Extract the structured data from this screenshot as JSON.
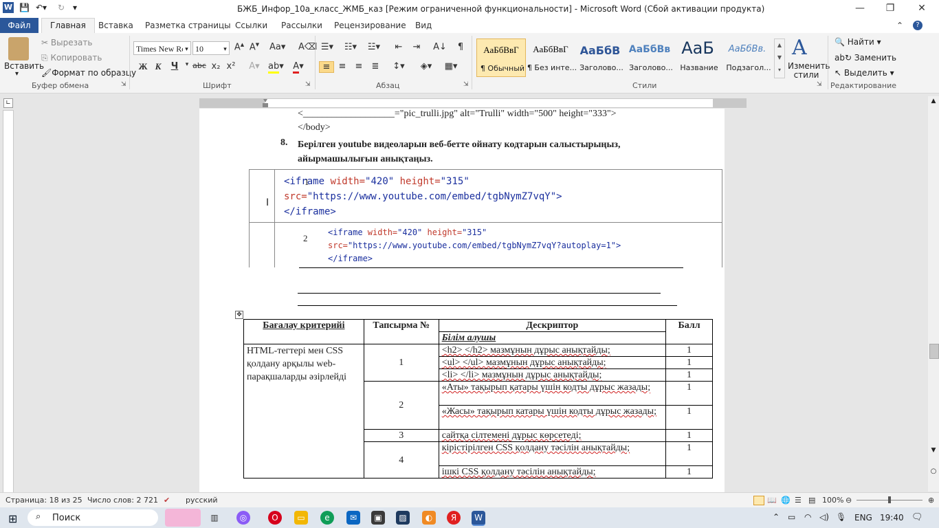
{
  "window": {
    "title": "БЖБ_Инфор_10а_класс_ЖМБ_каз [Режим ограниченной функциональности]  -  Microsoft Word (Сбой активации продукта)"
  },
  "tabs": [
    "Файл",
    "Главная",
    "Вставка",
    "Разметка страницы",
    "Ссылки",
    "Рассылки",
    "Рецензирование",
    "Вид"
  ],
  "ribbon": {
    "clipboard": {
      "paste": "Вставить",
      "cut": "Вырезать",
      "copy": "Копировать",
      "format_painter": "Формат по образцу",
      "group": "Буфер обмена"
    },
    "font": {
      "name": "Times New Ro",
      "size": "10",
      "group": "Шрифт"
    },
    "paragraph": {
      "group": "Абзац"
    },
    "styles": {
      "group": "Стили",
      "items": [
        {
          "preview": "АаБбВвГ",
          "name": "¶ Обычный"
        },
        {
          "preview": "АаБбВвГ",
          "name": "¶ Без инте..."
        },
        {
          "preview": "АаБбВ",
          "name": "Заголово..."
        },
        {
          "preview": "АаБбВв",
          "name": "Заголово..."
        },
        {
          "preview": "АаБ",
          "name": "Название"
        },
        {
          "preview": "АаБбВв.",
          "name": "Подзагол..."
        }
      ],
      "change_styles": "Изменить стили"
    },
    "editing": {
      "find": "Найти",
      "replace": "Заменить",
      "select": "Выделить",
      "group": "Редактирование"
    }
  },
  "document": {
    "line_top": "<___________________=\"pic_trulli.jpg\"  alt=\"Trulli\"  width=\"500\" height=\"333\">",
    "line_body": "</body>",
    "item_num": "8.",
    "item_text": "Берілген youtube видеоларын веб-бетте ойнату кодтарын салыстырыңыз, айырмашылығын анықтаңыз.",
    "code_rows": [
      {
        "num": "1",
        "tag": "<iframe",
        "a1": " width=",
        "v1": "\"420\"",
        "a2": " height=",
        "v2": "\"315\"",
        "a3": "src=",
        "v3": "\"https://www.youtube.com/embed/tgbNymZ7vqY\"",
        "close": ">",
        "end": "</iframe>"
      },
      {
        "num": "2",
        "tag": "<iframe",
        "a1": " width=",
        "v1": "\"420\"",
        "a2": " height=",
        "v2": "\"315\"",
        "a3": "src=",
        "v3": "\"https://www.youtube.com/embed/tgbNymZ7vqY?autoplay=1\"",
        "close": ">",
        "end": "</iframe>"
      }
    ],
    "criteria_table": {
      "headers": {
        "criterion": "Бағалау критерийі",
        "task": "Тапсырма №",
        "descriptor": "Дескриптор",
        "learner": "Білім алушы",
        "score": "Балл"
      },
      "criterion_text": "HTML-тегтері мен CSS қолдану арқылы web-парақшаларды әзірлейді",
      "rows": [
        {
          "task": "1",
          "desc": "<h2> </h2> мазмұнын дұрыс анықтайды;",
          "score": "1"
        },
        {
          "task": "",
          "desc": "<ul> </ul> мазмұнын дұрыс анықтайды;",
          "score": "1"
        },
        {
          "task": "",
          "desc": "<li> </li> мазмұнын дұрыс анықтайды;",
          "score": "1"
        },
        {
          "task": "2",
          "desc": "«Аты» тақырып қатары үшін кодты дұрыс жазады;",
          "score": "1"
        },
        {
          "task": "",
          "desc": "«Жасы» тақырып катары үшін кодты дұрыс жазады;",
          "score": "1"
        },
        {
          "task": "3",
          "desc": "сайтқа сілтемені дұрыс көрсетеді;",
          "score": "1"
        },
        {
          "task": "4",
          "desc": "кірістірілген CSS қолдану тәсілін анықтайды;",
          "score": "1"
        },
        {
          "task": "",
          "desc": "ішкі CSS қолдану тәсілін анықтайды;",
          "score": "1"
        }
      ]
    }
  },
  "status": {
    "page": "Страница: 18 из 25",
    "words": "Число слов: 2 721",
    "language": "русский",
    "zoom": "100%"
  },
  "taskbar": {
    "search": "Поиск",
    "lang": "ENG",
    "time": "19:40"
  }
}
